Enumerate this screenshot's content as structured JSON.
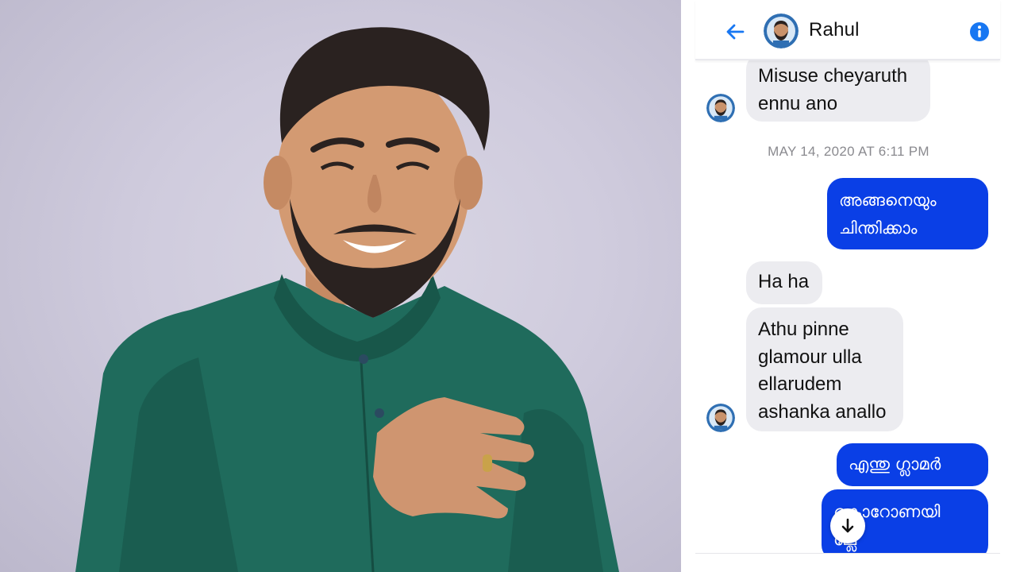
{
  "chat": {
    "contact_name": "Rahul",
    "timestamp": "MAY 14, 2020 AT 6:11 PM",
    "messages": [
      {
        "direction": "in",
        "lines": [
          "Misuse cheyaruth",
          "ennu ano"
        ]
      },
      {
        "direction": "out",
        "lines": [
          "അങ്ങനെയും",
          "ചിന്തിക്കാം"
        ]
      },
      {
        "direction": "in",
        "lines": [
          "Ha ha"
        ]
      },
      {
        "direction": "in",
        "lines": [
          "Athu pinne",
          "glamour ulla",
          "ellarudem",
          "ashanka anallo"
        ]
      },
      {
        "direction": "out",
        "lines": [
          "എന്തു ഗ്ലാമർ"
        ]
      },
      {
        "direction": "out",
        "lines": [
          "കൊറോണയി",
          "ല്ലേ"
        ]
      }
    ]
  },
  "icons": {
    "back": "arrow-left-icon",
    "info": "info-icon",
    "scroll": "arrow-down-icon"
  },
  "colors": {
    "accent": "#1877f2",
    "outgoing_bubble": "#0a3fe6",
    "incoming_bubble": "#ececf0",
    "shirt": "#1f6b5c",
    "backdrop": "#cfcbdd"
  }
}
